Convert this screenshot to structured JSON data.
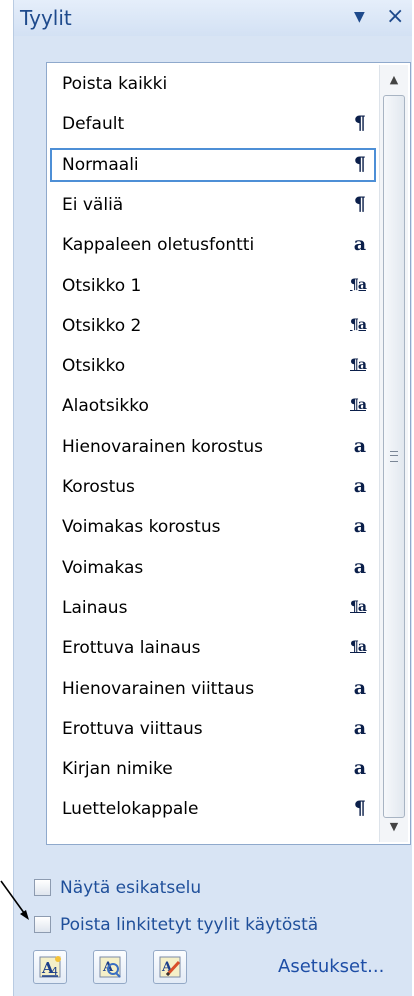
{
  "titlebar": {
    "title": "Tyylit",
    "dropdown_glyph": "▼",
    "close_glyph": "×"
  },
  "styles_list": {
    "items": [
      {
        "label": "Poista kaikki",
        "icon": ""
      },
      {
        "label": "Default",
        "icon": "¶"
      },
      {
        "label": "Normaali",
        "icon": "¶",
        "selected": true
      },
      {
        "label": "Ei väliä",
        "icon": "¶"
      },
      {
        "label": "Kappaleen oletusfontti",
        "icon": "a"
      },
      {
        "label": "Otsikko 1",
        "icon": "¶a"
      },
      {
        "label": "Otsikko 2",
        "icon": "¶a"
      },
      {
        "label": "Otsikko",
        "icon": "¶a"
      },
      {
        "label": "Alaotsikko",
        "icon": "¶a"
      },
      {
        "label": "Hienovarainen korostus",
        "icon": "a"
      },
      {
        "label": "Korostus",
        "icon": "a"
      },
      {
        "label": "Voimakas korostus",
        "icon": "a"
      },
      {
        "label": "Voimakas",
        "icon": "a"
      },
      {
        "label": "Lainaus",
        "icon": "¶a"
      },
      {
        "label": "Erottuva lainaus",
        "icon": "¶a"
      },
      {
        "label": "Hienovarainen viittaus",
        "icon": "a"
      },
      {
        "label": "Erottuva viittaus",
        "icon": "a"
      },
      {
        "label": "Kirjan nimike",
        "icon": "a"
      },
      {
        "label": "Luettelokappale",
        "icon": "¶"
      }
    ]
  },
  "options": {
    "preview_label": "Näytä esikatselu",
    "preview_checked": false,
    "disable_linked_label": "Poista linkitetyt tyylit käytöstä",
    "disable_linked_checked": false
  },
  "footer": {
    "new_style_icon": "new-style-icon",
    "style_inspector_icon": "style-inspector-icon",
    "manage_styles_icon": "manage-styles-icon",
    "settings_label": "Asetukset..."
  },
  "colors": {
    "pane_background": "#d8e4f4",
    "link_text": "#1e4ea6",
    "selection_border": "#4d8fd6"
  }
}
